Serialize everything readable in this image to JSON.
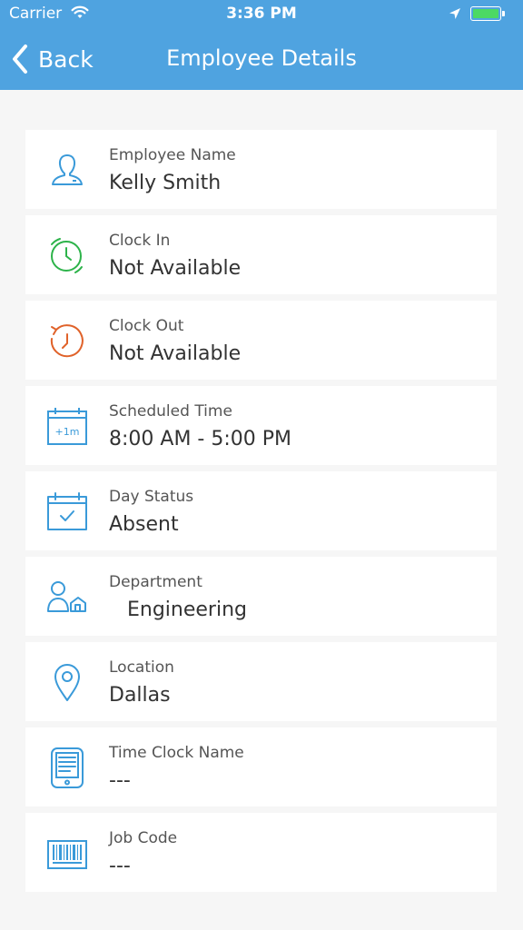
{
  "status_bar": {
    "carrier": "Carrier",
    "time": "3:36 PM"
  },
  "nav": {
    "back_label": "Back",
    "title": "Employee Details"
  },
  "fields": [
    {
      "label": "Employee Name",
      "value": "Kelly Smith",
      "icon": "employee-icon"
    },
    {
      "label": "Clock In",
      "value": "Not Available",
      "icon": "clock-in-icon"
    },
    {
      "label": "Clock Out",
      "value": "Not Available",
      "icon": "clock-out-icon"
    },
    {
      "label": "Scheduled Time",
      "value": "8:00 AM - 5:00 PM",
      "icon": "calendar-plus-icon",
      "icon_text": "+1m"
    },
    {
      "label": "Day Status",
      "value": "Absent",
      "icon": "calendar-check-icon"
    },
    {
      "label": "Department",
      "value": "Engineering",
      "icon": "department-icon"
    },
    {
      "label": "Location",
      "value": "Dallas",
      "icon": "location-pin-icon"
    },
    {
      "label": "Time Clock Name",
      "value": "---",
      "icon": "time-clock-device-icon"
    },
    {
      "label": "Job Code",
      "value": "---",
      "icon": "barcode-icon"
    }
  ],
  "colors": {
    "header": "#4fa3e0",
    "icon_blue": "#3a9ad9",
    "clock_in": "#2db34a",
    "clock_out": "#e0622a",
    "battery": "#4cd964"
  }
}
